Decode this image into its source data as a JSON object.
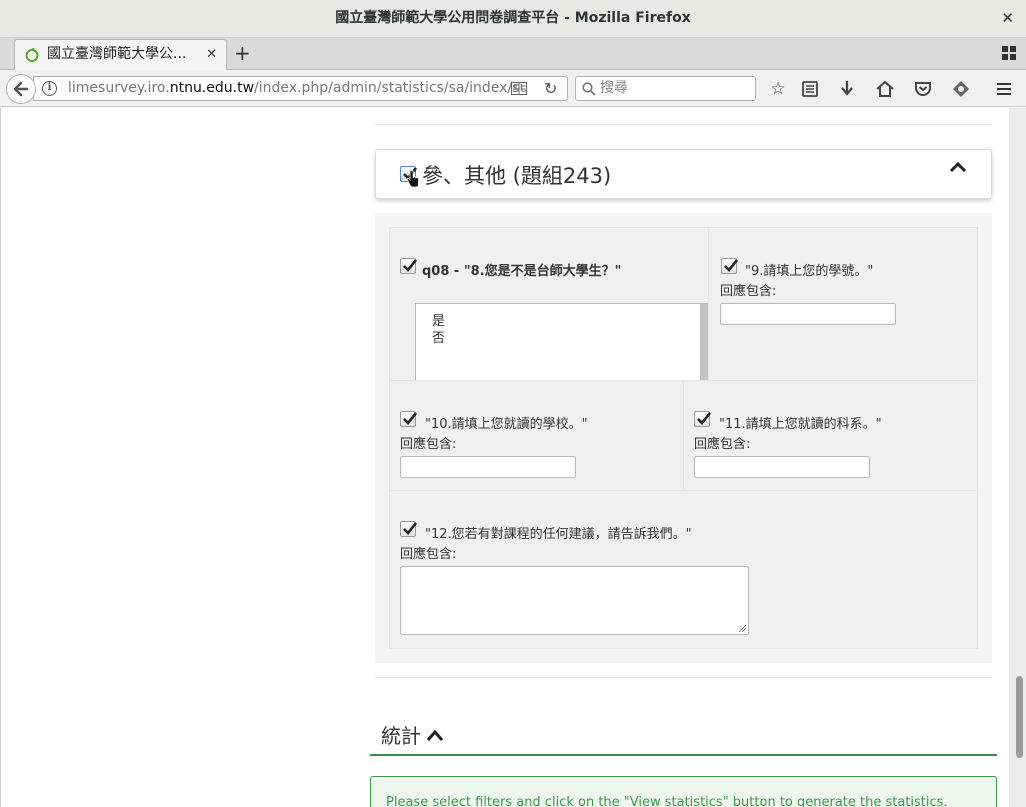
{
  "window": {
    "title": "國立臺灣師範大學公用問卷調查平台 - Mozilla Firefox",
    "close_glyph": "✕"
  },
  "tabs": [
    {
      "title": "國立臺灣師範大學公...",
      "close_glyph": "✕"
    }
  ],
  "new_tab_glyph": "+",
  "navbar": {
    "url_prefix": "limesurvey.iro.",
    "url_domain": "ntnu.edu.tw",
    "url_suffix": "/index.php/admin/statistics/sa/index/su",
    "search_placeholder": "搜尋"
  },
  "icons": {
    "back": "back-arrow-icon",
    "info": "info-icon",
    "reader": "reader-view-icon",
    "reload": "reload-icon",
    "search": "search-icon",
    "bookmark": "star-icon",
    "library": "library-icon",
    "downloads": "download-arrow-icon",
    "home": "home-icon",
    "pocket": "pocket-icon",
    "extension": "extension-icon",
    "menu": "hamburger-menu-icon"
  },
  "group": {
    "title": "參、其他 (題組243)",
    "checked": true
  },
  "questions": [
    {
      "id": "q08",
      "label": "q08 - \"8.您是不是台師大學生？\"",
      "checked": true,
      "options": [
        "是",
        "否"
      ]
    },
    {
      "label": "\"9.請填上您的學號。\"",
      "sublabel": "回應包含:",
      "checked": true,
      "value": ""
    },
    {
      "label": "\"10.請填上您就讀的學校。\"",
      "sublabel": "回應包含:",
      "checked": true,
      "value": ""
    },
    {
      "label": "\"11.請填上您就讀的科系。\"",
      "sublabel": "回應包含:",
      "checked": true,
      "value": ""
    },
    {
      "label": "\"12.您若有對課程的任何建議，請告訴我們。\"",
      "sublabel": "回應包含:",
      "checked": true,
      "value": ""
    }
  ],
  "stats": {
    "heading": "統計",
    "alert": "Please select filters and click on the \"View statistics\" button to generate the statistics."
  },
  "colors": {
    "accent_green": "#3c8c48",
    "alert_text": "#3c9a4b"
  }
}
